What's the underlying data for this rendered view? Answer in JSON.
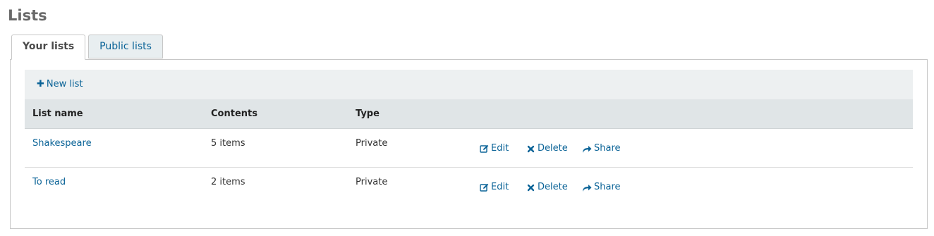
{
  "page": {
    "title": "Lists"
  },
  "tabs": [
    {
      "label": "Your lists",
      "active": true
    },
    {
      "label": "Public lists",
      "active": false
    }
  ],
  "toolbar": {
    "new_list_label": "New list"
  },
  "table": {
    "headers": [
      "List name",
      "Contents",
      "Type"
    ],
    "rows": [
      {
        "name": "Shakespeare",
        "contents": "5 items",
        "type": "Private",
        "actions": {
          "edit": "Edit",
          "delete": "Delete",
          "share": "Share"
        }
      },
      {
        "name": "To read",
        "contents": "2 items",
        "type": "Private",
        "actions": {
          "edit": "Edit",
          "delete": "Delete",
          "share": "Share"
        }
      }
    ]
  },
  "colors": {
    "link": "#0a6397",
    "title": "#696969",
    "toolbar_bg": "#edf0f1",
    "header_bg": "#e0e5e7"
  },
  "icons": {
    "new_list": "plus-icon",
    "edit": "edit-icon",
    "delete": "close-icon",
    "share": "share-icon"
  }
}
